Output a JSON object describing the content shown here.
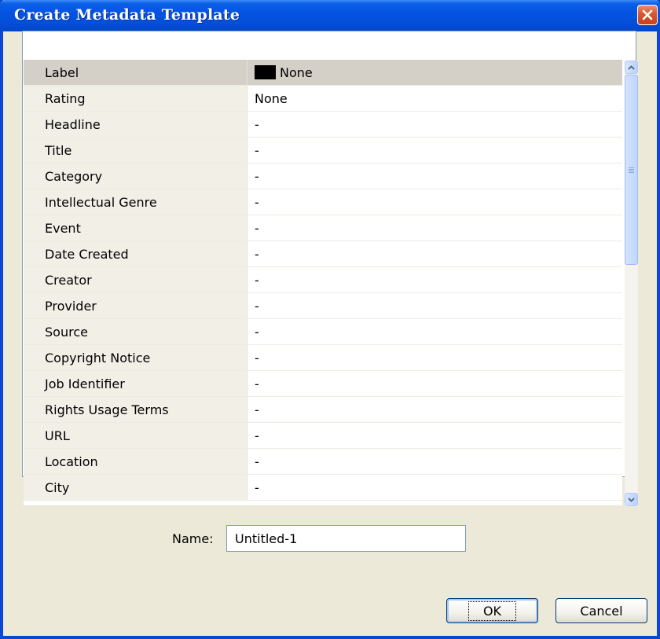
{
  "window": {
    "title": "Create Metadata Template",
    "close_icon": "close-x-icon"
  },
  "colors": {
    "titlebar": "#0553e3",
    "dialog_bg": "#ece9d8",
    "close_button": "#d9572f",
    "label_swatch": "#000000"
  },
  "metadata_grid": {
    "rows": [
      {
        "label": "Label",
        "value": "None",
        "swatch": true,
        "selected": true
      },
      {
        "label": "Rating",
        "value": "None"
      },
      {
        "label": "Headline",
        "value": "-"
      },
      {
        "label": "Title",
        "value": "-"
      },
      {
        "label": "Category",
        "value": "-"
      },
      {
        "label": "Intellectual Genre",
        "value": "-"
      },
      {
        "label": "Event",
        "value": "-"
      },
      {
        "label": "Date Created",
        "value": "-"
      },
      {
        "label": "Creator",
        "value": "-"
      },
      {
        "label": "Provider",
        "value": "-"
      },
      {
        "label": "Source",
        "value": "-"
      },
      {
        "label": "Copyright Notice",
        "value": "-"
      },
      {
        "label": "Job Identifier",
        "value": "-"
      },
      {
        "label": "Rights Usage Terms",
        "value": "-"
      },
      {
        "label": "URL",
        "value": "-"
      },
      {
        "label": "Location",
        "value": "-"
      },
      {
        "label": "City",
        "value": "-"
      }
    ]
  },
  "name_field": {
    "label": "Name:",
    "value": "Untitled-1"
  },
  "buttons": {
    "ok_label": "OK",
    "cancel_label": "Cancel"
  }
}
